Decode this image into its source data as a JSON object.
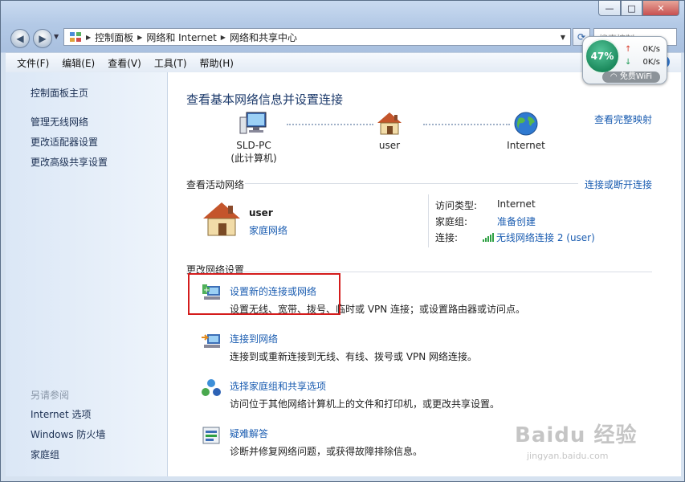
{
  "caption": {
    "minimize": "—",
    "maximize": "□",
    "close": "✕"
  },
  "nav": {
    "back": "◀",
    "forward": "▶"
  },
  "address": {
    "icon": "control-panel-icon",
    "crumbs": [
      "控制面板",
      "网络和 Internet",
      "网络和共享中心"
    ],
    "search_placeholder": "搜索控制..."
  },
  "menu": [
    "文件(F)",
    "编辑(E)",
    "查看(V)",
    "工具(T)",
    "帮助(H)"
  ],
  "left": {
    "links": [
      "控制面板主页",
      "管理无线网络",
      "更改适配器设置",
      "更改高级共享设置"
    ],
    "see_also_header": "另请参阅",
    "see_also": [
      "Internet 选项",
      "Windows 防火墙",
      "家庭组"
    ]
  },
  "main": {
    "title": "查看基本网络信息并设置连接",
    "full_map": "查看完整映射",
    "map_nodes": [
      {
        "label": "SLD-PC",
        "sub": "(此计算机)",
        "icon": "computer-icon"
      },
      {
        "label": "user",
        "sub": "",
        "icon": "house-icon"
      },
      {
        "label": "Internet",
        "sub": "",
        "icon": "globe-icon"
      }
    ],
    "active": {
      "header": "查看活动网络",
      "connect_link": "连接或断开连接",
      "network_name": "user",
      "network_type": "家庭网络",
      "access_type_key": "访问类型:",
      "access_type_val": "Internet",
      "homegroup_key": "家庭组:",
      "homegroup_val": "准备创建",
      "connection_key": "连接:",
      "connection_val": "无线网络连接 2 (user)"
    },
    "change": {
      "header": "更改网络设置",
      "tasks": [
        {
          "link": "设置新的连接或网络",
          "desc": "设置无线、宽带、拨号、临时或 VPN 连接；或设置路由器或访问点。",
          "icon": "new-connection-icon"
        },
        {
          "link": "连接到网络",
          "desc": "连接到或重新连接到无线、有线、拨号或 VPN 网络连接。",
          "icon": "connect-network-icon"
        },
        {
          "link": "选择家庭组和共享选项",
          "desc": "访问位于其他网络计算机上的文件和打印机，或更改共享设置。",
          "icon": "homegroup-icon"
        },
        {
          "link": "疑难解答",
          "desc": "诊断并修复网络问题，或获得故障排除信息。",
          "icon": "troubleshoot-icon"
        }
      ]
    }
  },
  "wifi": {
    "percent": "47%",
    "up": "0K/s",
    "down": "0K/s",
    "free": "免费WiFi"
  },
  "watermark": {
    "brand": "Baidu 经验",
    "url": "jingyan.baidu.com"
  },
  "colors": {
    "link": "#1b5db1",
    "highlight": "#d41c1c",
    "wifi_green": "#1c8a5d"
  }
}
